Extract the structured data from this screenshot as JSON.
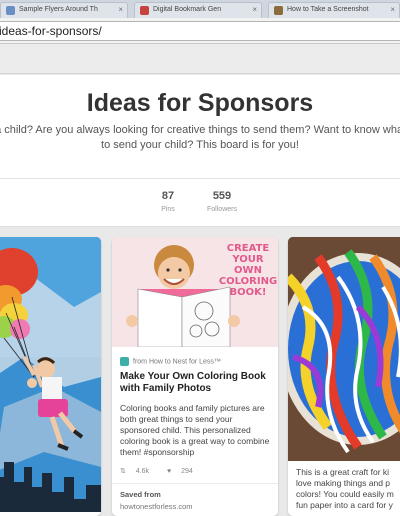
{
  "browser": {
    "tabs": [
      {
        "label": "Sample Flyers Around Th",
        "color": "#6a8fc7"
      },
      {
        "label": "Digital Bookmark Gen",
        "color": "#c7433b"
      },
      {
        "label": "How to Take a Screenshot",
        "color": "#8a6d3b"
      }
    ],
    "url": "ideas-for-sponsors/"
  },
  "board": {
    "title": "Ideas for Sponsors",
    "description_line1": "r a child? Are you always looking for creative things to send them? Want to know what i",
    "description_line2": "to send your child? This board is for you!",
    "pins_count": "87",
    "pins_label": "Pins",
    "followers_count": "559",
    "followers_label": "Followers"
  },
  "pins": {
    "coloring": {
      "image_text_line1": "CREATE",
      "image_text_line2": "YOUR OWN",
      "image_text_line3": "COLORING",
      "image_text_line4": "BOOK!",
      "source": "from How to Nest for Less™",
      "title": "Make Your Own Coloring Book with Family Photos",
      "description": "Coloring books and family pictures are both great things to send your sponsored child. This personalized coloring book is a great way to combine them! #sponsorship",
      "repins": "4.6k",
      "likes": "294",
      "saved_label": "Saved from",
      "saved_site": "howtonestforless.com"
    },
    "marble": {
      "desc_line1": "This is a great craft for ki",
      "desc_line2": "love making things and p",
      "desc_line3": "colors! You could easily m",
      "desc_line4": "fun paper into a card for y"
    }
  },
  "colors": {
    "teal_icon": "#3cb0a8",
    "pink_title": "#e25a8c"
  }
}
